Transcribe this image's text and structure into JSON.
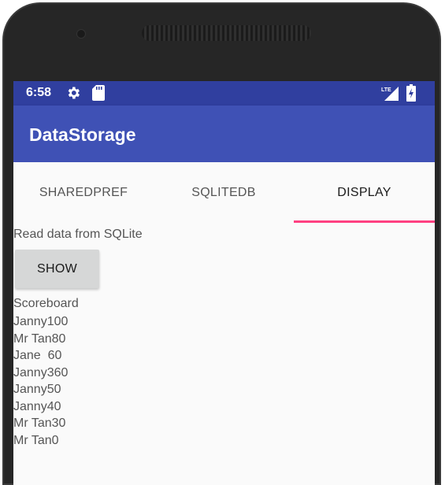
{
  "status_bar": {
    "time": "6:58",
    "icons": [
      "gear-icon",
      "sd-card-icon",
      "lte-signal-icon",
      "battery-charging-icon"
    ],
    "background": "#303f9f"
  },
  "app_bar": {
    "title": "DataStorage",
    "background": "#3f51b5"
  },
  "tabs": [
    {
      "label": "SHAREDPREF",
      "active": false
    },
    {
      "label": "SQLITEDB",
      "active": false
    },
    {
      "label": "DISPLAY",
      "active": true
    }
  ],
  "tab_indicator_color": "#ff4081",
  "content": {
    "description": "Read data from SQLite",
    "show_button_label": "SHOW",
    "scoreboard_title": "Scoreboard",
    "scores": [
      "Janny100",
      "Mr Tan80",
      "Jane  60",
      "Janny360",
      "Janny50",
      "Janny40",
      "Mr Tan30",
      "Mr Tan0"
    ]
  }
}
